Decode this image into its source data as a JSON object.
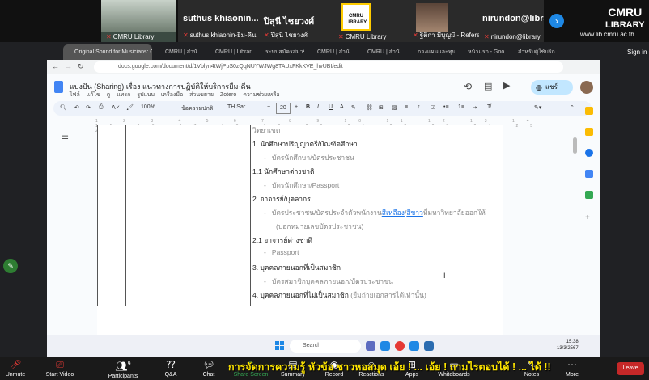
{
  "zoom_top": {
    "tiles": [
      {
        "name": "CMRU Library"
      },
      {
        "name": "suthus khiaonin-ยืม-คืน"
      },
      {
        "name": "ปิสุนี ไชยวงศ์"
      },
      {
        "name": "CMRU Library"
      },
      {
        "name": "ฐิติกา มีบุญมี - Reference"
      },
      {
        "name": "nirundon@library"
      }
    ],
    "large_names": [
      "suthus  khiaonin...",
      "ปิสุนี  ไชยวงศ์",
      "nirundon@library"
    ],
    "logo_text": "CMRU",
    "logo_sub": "LIBRARY",
    "url": "www.lib.cmru.ac.th"
  },
  "chrome": {
    "tabs": [
      "Original Sound for Musicians: Off",
      "CMRU | สำนั...",
      "CMRU | Librar...",
      "ระบบสมัครสมาชิก...",
      "CMRU | สำนั...",
      "CMRU | สำนั...",
      "กองแผนและทุน...",
      "หน้าแรก - Goo...",
      "สำหรับผู้ใช้บริก..."
    ],
    "url": "docs.google.com/document/d/1Vblyn4tWjPpS0zQqNUYWJWg8TAUxFKkKVE_hvUBI/edit",
    "sign_in": "Sign in"
  },
  "docs": {
    "title": "แบ่งปัน (Sharing) เรื่อง แนวทางการปฏิบัติให้บริการยืม-คืน",
    "menu": [
      "ไฟล์",
      "แก้ไข",
      "ดู",
      "แทรก",
      "รูปแบบ",
      "เครื่องมือ",
      "ส่วนขยาย",
      "Zotero",
      "ความช่วยเหลือ"
    ],
    "share_label": "แชร์",
    "toolbar": {
      "zoom": "100%",
      "style": "ข้อความปกติ",
      "font": "TH Sar...",
      "size": "20"
    },
    "ruler_ticks": [
      "1",
      "2",
      "3",
      "4",
      "5",
      "6",
      "7",
      "8",
      "9",
      "10",
      "11",
      "12",
      "13",
      "14",
      "15",
      "16",
      "17",
      "18",
      "19",
      "20",
      "21",
      "22",
      "23",
      "24",
      "25",
      "26",
      "27"
    ],
    "content": {
      "top_cut": "วิทยาเขต",
      "l1": "1. นักศึกษาปริญญาตรี/บัณฑิตศึกษา",
      "l1a": "บัตรนักศึกษา/บัตรประชาชน",
      "l2": "1.1 นักศึกษาต่างชาติ",
      "l2a": "บัตรนักศึกษา/Passport",
      "l3": "2. อาจารย์/บุคลากร",
      "l3a_pre": "บัตรประชาชน/บัตรประจำตัวพนักงาน",
      "l3a_link1": "สีเหลือง",
      "l3a_slash": "/",
      "l3a_link2": "สีขาว",
      "l3a_post": "ที่มหาวิทยาลัยออกให้",
      "l3b": "(บอกหมายเลขบัตรประชาชน)",
      "l4": "2.1 อาจารย์ต่างชาติ",
      "l4a": "Passport",
      "l5": "3. บุคคลภายนอกที่เป็นสมาชิก",
      "l5a": "บัตรสมาชิกบุคคลภายนอก/บัตรประชาชน",
      "l6": "4. บุคคลภายนอกที่ไม่เป็นสมาชิก",
      "l6_note": "(ยืมถ่ายเอกสารได้เท่านั้น)"
    }
  },
  "taskbar": {
    "search": "Search",
    "time": "15:38",
    "date": "13/3/2567"
  },
  "zoom_bottom": {
    "buttons": [
      "Unmute",
      "Start Video",
      "Participants",
      "Q&A",
      "Chat",
      "Share Screen",
      "Summary",
      "Record",
      "Reactions",
      "Apps",
      "Whiteboards",
      "Notes",
      "More",
      "Leave"
    ],
    "participants_count": "9",
    "subtitle": "การจัดการความรู้ หัวข้อ ชาวหอสมุด เอ้ย ! ... เอ้ย ! ถามไรตอบได้ ! ... ได้ !!"
  },
  "colors": {
    "link": "#1a73e8",
    "subtitle": "#ffe600",
    "share_bg": "#c2e7ff",
    "mic_off": "#e53935"
  }
}
